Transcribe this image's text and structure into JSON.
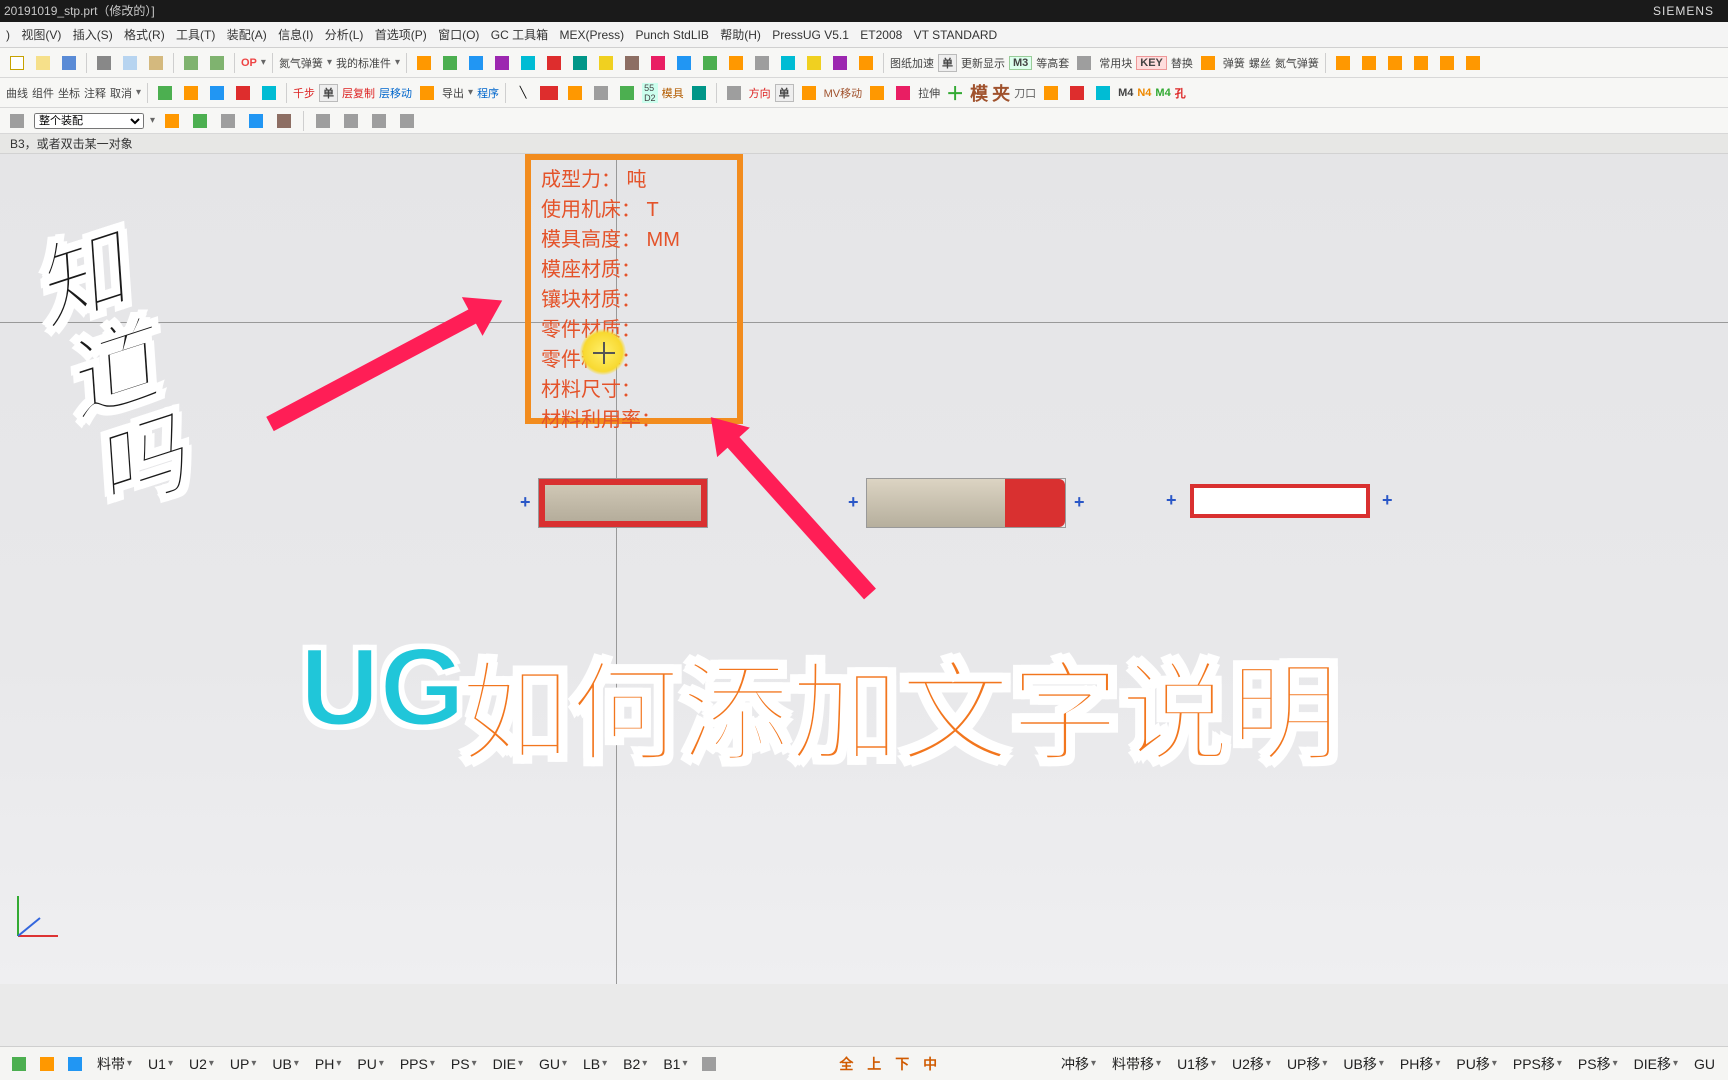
{
  "titlebar": {
    "filename": "20191019_stp.prt（修改的）]",
    "brand": "SIEMENS"
  },
  "menubar": {
    "items": [
      ")",
      "视图(V)",
      "插入(S)",
      "格式(R)",
      "工具(T)",
      "装配(A)",
      "信息(I)",
      "分析(L)",
      "首选项(P)",
      "窗口(O)",
      "GC 工具箱",
      "MEX(Press)",
      "Punch StdLIB",
      "帮助(H)",
      "PressUG V5.1",
      "ET2008",
      "VT STANDARD"
    ]
  },
  "toolbar1": {
    "op": "OP",
    "tags": [
      "氮气弹簧",
      "我的标准件"
    ],
    "right": [
      "图纸加速",
      "单",
      "更新显示",
      "M3",
      "等高套",
      "常用块",
      "KEY",
      "替换",
      "弹簧",
      "螺丝",
      "氮气弹簧"
    ]
  },
  "toolbar2": {
    "items": [
      "曲线",
      "组件",
      "坐标",
      "注释",
      "取消"
    ],
    "labels": [
      "千步",
      "单",
      "层复制",
      "层移动",
      "导出",
      "程序"
    ],
    "d2": "55\nD2",
    "mo": "模具",
    "right": [
      "方向",
      "单",
      "MV移动",
      "拉伸",
      "模",
      "夹",
      "刀口",
      "M4",
      "N4",
      "M4",
      "孔"
    ]
  },
  "selector": {
    "value": "整个装配"
  },
  "hint": "B3，或者双击某一对象",
  "params": {
    "l1": "成型力：    吨",
    "l2": "使用机床：    T",
    "l3": "模具高度：  MM",
    "l4": "模座材质：",
    "l5": "镶块材质：",
    "l6": "零件材质：",
    "l7": "零件料厚：",
    "l8": "材料尺寸：",
    "l9": "材料利用率："
  },
  "overlay": {
    "zd": "知\n道\n吗",
    "ug": "UG",
    "desc": "如何添加文字说明"
  },
  "bottombar": {
    "left": [
      "料带"
    ],
    "u": [
      "U1",
      "U2",
      "UP",
      "UB",
      "PH",
      "PU",
      "PPS",
      "PS",
      "DIE",
      "GU",
      "LB",
      "B2",
      "B1"
    ],
    "mid": [
      "全",
      "上",
      "下",
      "中"
    ],
    "right_lbls": [
      "冲移",
      "料带移",
      "U1移",
      "U2移",
      "UP移",
      "UB移",
      "PH移",
      "PU移",
      "PPS移",
      "PS移",
      "DIE移",
      "GU"
    ]
  }
}
